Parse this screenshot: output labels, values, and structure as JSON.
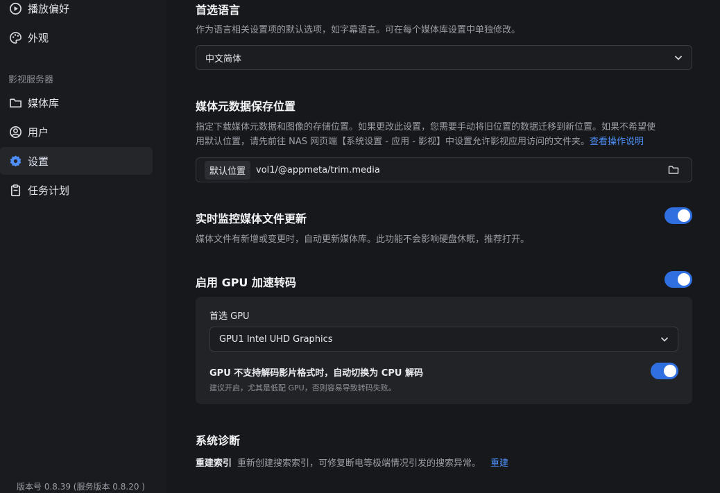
{
  "sidebar": {
    "items_top": [
      {
        "label": "播放偏好",
        "icon": "play-circle-icon"
      },
      {
        "label": "外观",
        "icon": "palette-icon"
      }
    ],
    "section_label": "影视服务器",
    "items": [
      {
        "label": "媒体库",
        "icon": "folder-icon"
      },
      {
        "label": "用户",
        "icon": "user-circle-icon"
      },
      {
        "label": "设置",
        "icon": "gear-icon",
        "active": true
      },
      {
        "label": "任务计划",
        "icon": "clipboard-icon"
      }
    ],
    "version": "版本号 0.8.39 (服务版本 0.8.20 )"
  },
  "language": {
    "title": "首选语言",
    "desc": "作为语言相关设置项的默认选项，如字幕语言。可在每个媒体库设置中单独修改。",
    "value": "中文简体"
  },
  "metadata": {
    "title": "媒体元数据保存位置",
    "desc_line1": "指定下载媒体元数据和图像的存储位置。如果更改此设置，您需要手动将旧位置的数据迁移到新位置。如果不希望使",
    "desc_line2": "用默认位置，请先前往 NAS 网页端【系统设置 - 应用 - 影视】中设置允许影视应用访问的文件夹。",
    "link": "查看操作说明",
    "tag": "默认位置",
    "path": "vol1/@appmeta/trim.media"
  },
  "monitor": {
    "title": "实时监控媒体文件更新",
    "desc": "媒体文件有新增或变更时，自动更新媒体库。此功能不会影响硬盘休眠，推荐打开。",
    "enabled": true
  },
  "gpu": {
    "title": "启用 GPU 加速转码",
    "enabled": true,
    "preferred_label": "首选 GPU",
    "preferred_value": "GPU1 Intel UHD Graphics",
    "fallback_title": "GPU 不支持解码影片格式时，自动切换为 CPU 解码",
    "fallback_desc": "建议开启，尤其是低配 GPU，否则容易导致转码失败。",
    "fallback_enabled": true
  },
  "diagnostics": {
    "title": "系统诊断",
    "reindex_name": "重建索引",
    "reindex_desc": "重新创建搜索索引，可修复断电等极端情况引发的搜索异常。",
    "reindex_action": "重建"
  },
  "colors": {
    "accent": "#2f6fdf",
    "link": "#4d8ef7",
    "background": "#17181b",
    "sidebar": "#1a1b1e"
  }
}
